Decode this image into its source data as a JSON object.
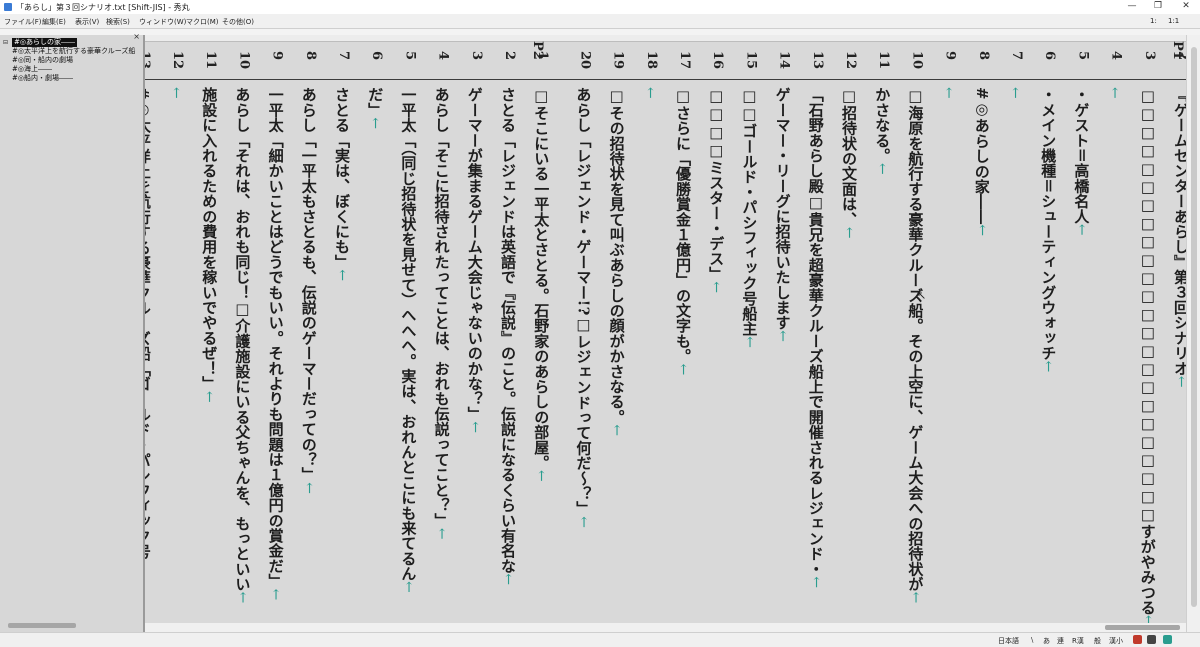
{
  "window": {
    "title": "「あらし」第３回シナリオ.txt [Shift-JIS] - 秀丸",
    "controls": {
      "minimize": "—",
      "maximize": "❐",
      "close": "✕"
    }
  },
  "menu": [
    {
      "label": "ファイル(F)"
    },
    {
      "label": "編集(E)"
    },
    {
      "label": "表示(V)"
    },
    {
      "label": "検索(S)"
    },
    {
      "label": "ウィンドウ(W)"
    },
    {
      "label": "マクロ(M)"
    },
    {
      "label": "その他(O)"
    }
  ],
  "cursor_position": {
    "line": "1:",
    "col": "1:1"
  },
  "outline": {
    "close_glyph": "×",
    "items": [
      {
        "label": "#◎あらしの家――",
        "selected": true
      },
      {
        "label": "#◎太平洋上を航行する豪華クルーズ船",
        "selected": false
      },
      {
        "label": "#◎同・船内の劇場",
        "selected": false
      },
      {
        "label": "#◎海上――",
        "selected": false
      },
      {
        "label": "#◎船内・劇場――",
        "selected": false
      }
    ]
  },
  "editor": {
    "page_labels": [
      "P1",
      "P2"
    ],
    "return_glyph": "←",
    "lines": [
      {
        "no": "2",
        "text": "『ゲームセンターあらし』第３回シナリオ"
      },
      {
        "no": "3",
        "text": "□□□□□□□□□□□□□□□□□□□□□□□□すがやみつる"
      },
      {
        "no": "4",
        "text": ""
      },
      {
        "no": "5",
        "text": "・ゲスト＝高橋名人"
      },
      {
        "no": "6",
        "text": "・メイン機種＝シューティングウォッチ"
      },
      {
        "no": "7",
        "text": ""
      },
      {
        "no": "8",
        "text": "#◎あらしの家――"
      },
      {
        "no": "9",
        "text": ""
      },
      {
        "no": "10",
        "text": "□海原を航行する豪華クルーズ船。その上空に、ゲーム大会への招待状が"
      },
      {
        "no": "11",
        "text": "かさなる。"
      },
      {
        "no": "12",
        "text": "□招待状の文面は、"
      },
      {
        "no": "13",
        "text": "「石野あらし殿□貴兄を超豪華クルーズ船上で開催されるレジェンド・"
      },
      {
        "no": "14",
        "text": "ゲーマー・リーグに招待いたします"
      },
      {
        "no": "15",
        "text": "□□ゴールド・パシフィック号船主"
      },
      {
        "no": "16",
        "text": "□□□□ミスター・デス」"
      },
      {
        "no": "17",
        "text": "□さらに「優勝賞金１億円」の文字も。"
      },
      {
        "no": "18",
        "text": ""
      },
      {
        "no": "19",
        "text": "□その招待状を見て叫ぶあらしの顔がかさなる。"
      },
      {
        "no": "20",
        "text": "あらし「レジェンド・ゲーマー!?□レジェンドって何だ～？」"
      },
      {
        "no": "1",
        "text": "□そこにいる一平太とさとる。石野家のあらしの部屋。"
      },
      {
        "no": "2",
        "text": "さとる「レジェンドは英語で『伝説』のこと。伝説になるくらい有名な"
      },
      {
        "no": "3",
        "text": "ゲーマーが集まるゲーム大会じゃないのかな？」"
      },
      {
        "no": "4",
        "text": "あらし「そこに招待されたってことは、おれも伝説ってこと？」"
      },
      {
        "no": "5",
        "text": "一平太「（同じ招待状を見せて）へへへ。実は、おれんとこにも来てるん"
      },
      {
        "no": "6",
        "text": "だ」"
      },
      {
        "no": "7",
        "text": "さとる「実は、ぼくにも」"
      },
      {
        "no": "8",
        "text": "あらし「一平太もさとるも、伝説のゲーマーだっての？」"
      },
      {
        "no": "9",
        "text": "一平太「細かいことはどうでもいい。それよりも問題は１億円の賞金だ」"
      },
      {
        "no": "10",
        "text": "あらし「それは、おれも同じ！□介護施設にいる父ちゃんを、もっといい"
      },
      {
        "no": "11",
        "text": "施設に入れるための費用を稼いでやるぜ！」"
      },
      {
        "no": "12",
        "text": ""
      },
      {
        "no": "13",
        "text": "#◎太平洋上を航行する豪華クルーズ船「ゴールド・パシフィック号"
      }
    ]
  },
  "status": {
    "ime_mode": "日本語",
    "indicators": [
      "\\",
      "あ",
      "連",
      "R漢",
      "般",
      "漢小"
    ]
  },
  "colors": {
    "return_marker": "#2a9d8f",
    "background": "#d9d9d9",
    "selection": "#111111"
  }
}
